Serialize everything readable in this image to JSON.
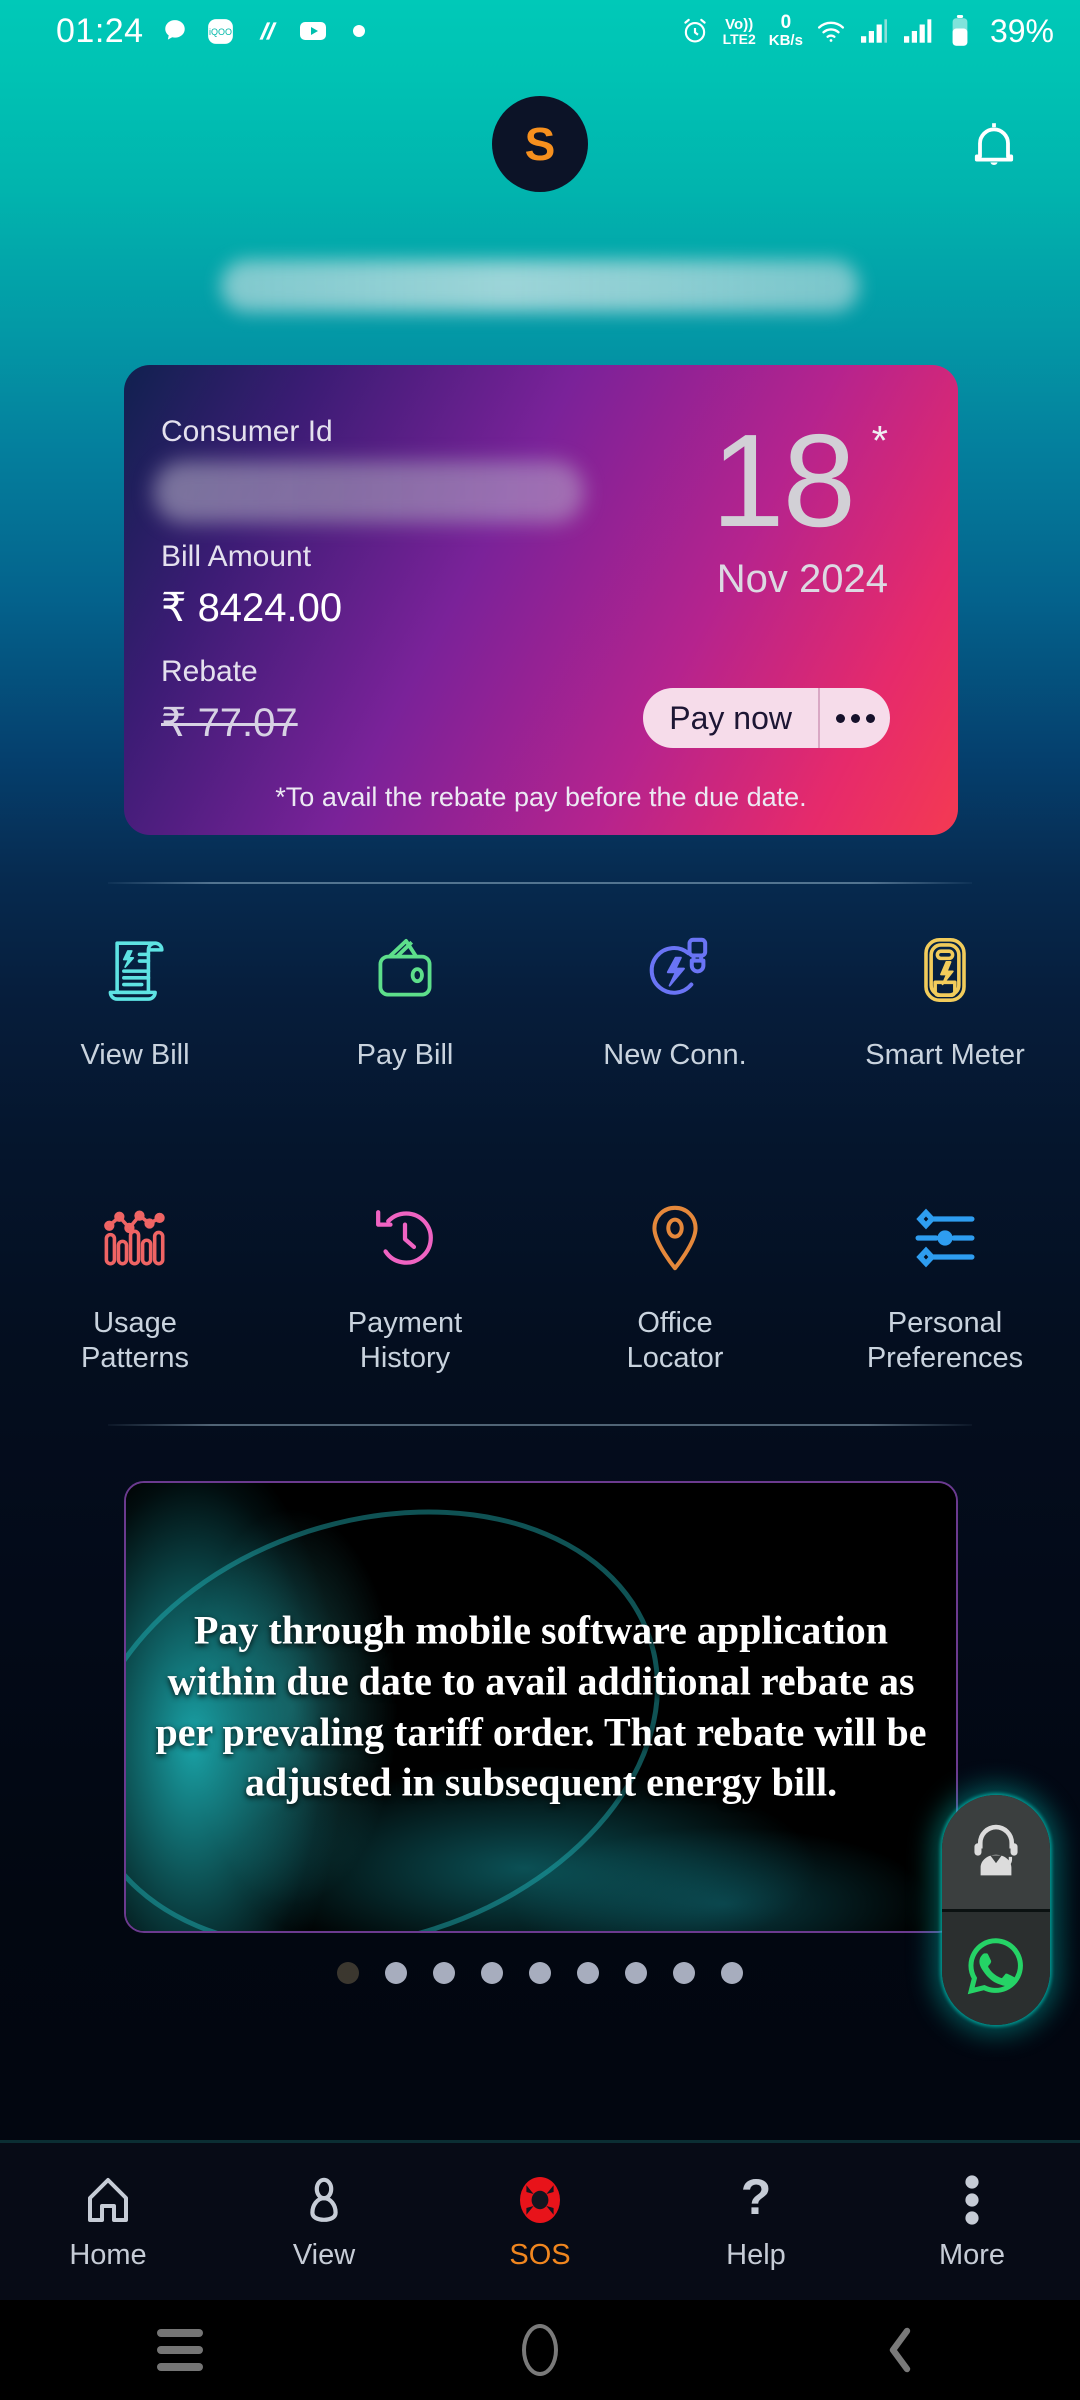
{
  "status_bar": {
    "time": "01:24",
    "left_icons": [
      "chat-bubble-icon",
      "iqoo-app-icon",
      "music-app-icon",
      "youtube-icon",
      "dot-icon"
    ],
    "alarm_icon": "alarm-clock-icon",
    "network_label_top": "Vo))",
    "network_label_bottom": "LTE2",
    "data_rate_value": "0",
    "data_rate_unit": "KB/s",
    "wifi_icon": "wifi-icon",
    "signal_icon_1": "signal-bars-icon",
    "signal_icon_2": "signal-bars-icon",
    "battery_icon": "battery-icon",
    "battery_percent": "39%"
  },
  "header": {
    "avatar_initial": "S",
    "avatar_bg": "#0c1327",
    "avatar_text_color": "#f7901e",
    "notification_icon": "bell-icon",
    "account_name_masked": ""
  },
  "bill_card": {
    "consumer_id_label": "Consumer Id",
    "consumer_id_value_masked": "",
    "bill_amount_label": "Bill Amount",
    "bill_amount_value": "₹ 8424.00",
    "rebate_label": "Rebate",
    "rebate_value": "₹ 77.07",
    "due_day": "18",
    "due_asterisk": "*",
    "due_month_year": "Nov 2024",
    "pay_button_label": "Pay now",
    "more_options_icon": "three-dots-icon",
    "footnote": "*To avail the rebate pay before the due date.",
    "gradient_start": "#10214f",
    "gradient_end": "#f43a52",
    "pay_button_bg": "#f6dcea"
  },
  "shortcuts": {
    "row1": [
      {
        "label": "View Bill",
        "icon": "bill-document-icon",
        "color": "#5ee3e3"
      },
      {
        "label": "Pay Bill",
        "icon": "wallet-icon",
        "color": "#5ddf8b"
      },
      {
        "label": "New Conn.",
        "icon": "power-plug-icon",
        "color": "#6a74f5"
      },
      {
        "label": "Smart Meter",
        "icon": "smart-meter-icon",
        "color": "#f2cc5b"
      }
    ],
    "row2": [
      {
        "label": "Usage\nPatterns",
        "label_line1": "Usage",
        "label_line2": "Patterns",
        "icon": "usage-chart-icon",
        "color": "#ef6464"
      },
      {
        "label": "Payment\nHistory",
        "label_line1": "Payment",
        "label_line2": "History",
        "icon": "clock-rewind-icon",
        "color": "#ef63c2"
      },
      {
        "label": "Office\nLocator",
        "label_line1": "Office",
        "label_line2": "Locator",
        "icon": "map-pin-icon",
        "color": "#e5883b"
      },
      {
        "label": "Personal\nPreferences",
        "label_line1": "Personal",
        "label_line2": "Preferences",
        "icon": "sliders-icon",
        "color": "#2e9df0"
      }
    ]
  },
  "banner": {
    "text": "Pay through mobile software application within due date to avail additional rebate as per prevaling tariff order. That rebate will be adjusted in subsequent energy bill.",
    "border_color": "#6b3a8f",
    "carousel": {
      "total_dots": 9,
      "active_index": 0
    }
  },
  "floating_buttons": {
    "support_icon": "customer-support-headset-icon",
    "whatsapp_icon": "whatsapp-icon",
    "whatsapp_color": "#25D366",
    "glow_color": "#00c8be"
  },
  "bottom_nav": {
    "items": [
      {
        "label": "Home",
        "icon": "home-icon",
        "active": false
      },
      {
        "label": "View",
        "icon": "person-icon",
        "active": false
      },
      {
        "label": "SOS",
        "icon": "sos-lifering-icon",
        "active": true,
        "color": "#f0861f",
        "icon_color": "#e8131a"
      },
      {
        "label": "Help",
        "icon": "question-mark-icon",
        "active": false
      },
      {
        "label": "More",
        "icon": "vertical-dots-icon",
        "active": false
      }
    ]
  },
  "android_nav": {
    "recents_icon": "recents-menu-icon",
    "home_icon": "home-circle-icon",
    "back_icon": "back-chevron-icon"
  }
}
